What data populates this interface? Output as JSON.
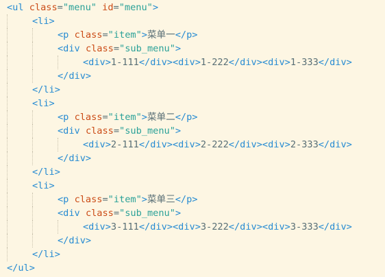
{
  "colors": {
    "background": "#fdf6e3",
    "tag": "#268bd2",
    "attribute": "#cb4b16",
    "string": "#2aa198",
    "text": "#586e75"
  },
  "lines": [
    {
      "indent": 0,
      "tokens": [
        [
          "tag",
          "<ul"
        ],
        [
          "plain",
          " "
        ],
        [
          "attr",
          "class"
        ],
        [
          "plain",
          "="
        ],
        [
          "val",
          "\"menu\""
        ],
        [
          "plain",
          " "
        ],
        [
          "attr",
          "id"
        ],
        [
          "plain",
          "="
        ],
        [
          "val",
          "\"menu\""
        ],
        [
          "tag",
          ">"
        ]
      ]
    },
    {
      "indent": 1,
      "tokens": [
        [
          "tag",
          "<li>"
        ]
      ]
    },
    {
      "indent": 2,
      "tokens": [
        [
          "tag",
          "<p"
        ],
        [
          "plain",
          " "
        ],
        [
          "attr",
          "class"
        ],
        [
          "plain",
          "="
        ],
        [
          "val",
          "\"item\""
        ],
        [
          "tag",
          ">"
        ],
        [
          "plain",
          "菜单一"
        ],
        [
          "tag",
          "</p>"
        ]
      ]
    },
    {
      "indent": 2,
      "tokens": [
        [
          "tag",
          "<div"
        ],
        [
          "plain",
          " "
        ],
        [
          "attr",
          "class"
        ],
        [
          "plain",
          "="
        ],
        [
          "val",
          "\"sub_menu\""
        ],
        [
          "tag",
          ">"
        ]
      ]
    },
    {
      "indent": 3,
      "tokens": [
        [
          "tag",
          "<div>"
        ],
        [
          "plain",
          "1-111"
        ],
        [
          "tag",
          "</div>"
        ],
        [
          "tag",
          "<div>"
        ],
        [
          "plain",
          "1-222"
        ],
        [
          "tag",
          "</div>"
        ],
        [
          "tag",
          "<div>"
        ],
        [
          "plain",
          "1-333"
        ],
        [
          "tag",
          "</div>"
        ]
      ]
    },
    {
      "indent": 2,
      "tokens": [
        [
          "tag",
          "</div>"
        ]
      ]
    },
    {
      "indent": 1,
      "tokens": [
        [
          "tag",
          "</li>"
        ]
      ]
    },
    {
      "indent": 1,
      "tokens": [
        [
          "tag",
          "<li>"
        ]
      ]
    },
    {
      "indent": 2,
      "tokens": [
        [
          "tag",
          "<p"
        ],
        [
          "plain",
          " "
        ],
        [
          "attr",
          "class"
        ],
        [
          "plain",
          "="
        ],
        [
          "val",
          "\"item\""
        ],
        [
          "tag",
          ">"
        ],
        [
          "plain",
          "菜单二"
        ],
        [
          "tag",
          "</p>"
        ]
      ]
    },
    {
      "indent": 2,
      "tokens": [
        [
          "tag",
          "<div"
        ],
        [
          "plain",
          " "
        ],
        [
          "attr",
          "class"
        ],
        [
          "plain",
          "="
        ],
        [
          "val",
          "\"sub_menu\""
        ],
        [
          "tag",
          ">"
        ]
      ]
    },
    {
      "indent": 3,
      "tokens": [
        [
          "tag",
          "<div>"
        ],
        [
          "plain",
          "2-111"
        ],
        [
          "tag",
          "</div>"
        ],
        [
          "tag",
          "<div>"
        ],
        [
          "plain",
          "2-222"
        ],
        [
          "tag",
          "</div>"
        ],
        [
          "tag",
          "<div>"
        ],
        [
          "plain",
          "2-333"
        ],
        [
          "tag",
          "</div>"
        ]
      ]
    },
    {
      "indent": 2,
      "tokens": [
        [
          "tag",
          "</div>"
        ]
      ]
    },
    {
      "indent": 1,
      "tokens": [
        [
          "tag",
          "</li>"
        ]
      ]
    },
    {
      "indent": 1,
      "tokens": [
        [
          "tag",
          "<li>"
        ]
      ]
    },
    {
      "indent": 2,
      "tokens": [
        [
          "tag",
          "<p"
        ],
        [
          "plain",
          " "
        ],
        [
          "attr",
          "class"
        ],
        [
          "plain",
          "="
        ],
        [
          "val",
          "\"item\""
        ],
        [
          "tag",
          ">"
        ],
        [
          "plain",
          "菜单三"
        ],
        [
          "tag",
          "</p>"
        ]
      ]
    },
    {
      "indent": 2,
      "tokens": [
        [
          "tag",
          "<div"
        ],
        [
          "plain",
          " "
        ],
        [
          "attr",
          "class"
        ],
        [
          "plain",
          "="
        ],
        [
          "val",
          "\"sub_menu\""
        ],
        [
          "tag",
          ">"
        ]
      ]
    },
    {
      "indent": 3,
      "tokens": [
        [
          "tag",
          "<div>"
        ],
        [
          "plain",
          "3-111"
        ],
        [
          "tag",
          "</div>"
        ],
        [
          "tag",
          "<div>"
        ],
        [
          "plain",
          "3-222"
        ],
        [
          "tag",
          "</div>"
        ],
        [
          "tag",
          "<div>"
        ],
        [
          "plain",
          "3-333"
        ],
        [
          "tag",
          "</div>"
        ]
      ]
    },
    {
      "indent": 2,
      "tokens": [
        [
          "tag",
          "</div>"
        ]
      ]
    },
    {
      "indent": 1,
      "tokens": [
        [
          "tag",
          "</li>"
        ]
      ]
    },
    {
      "indent": 0,
      "tokens": [
        [
          "tag",
          "</ul>"
        ]
      ]
    }
  ]
}
